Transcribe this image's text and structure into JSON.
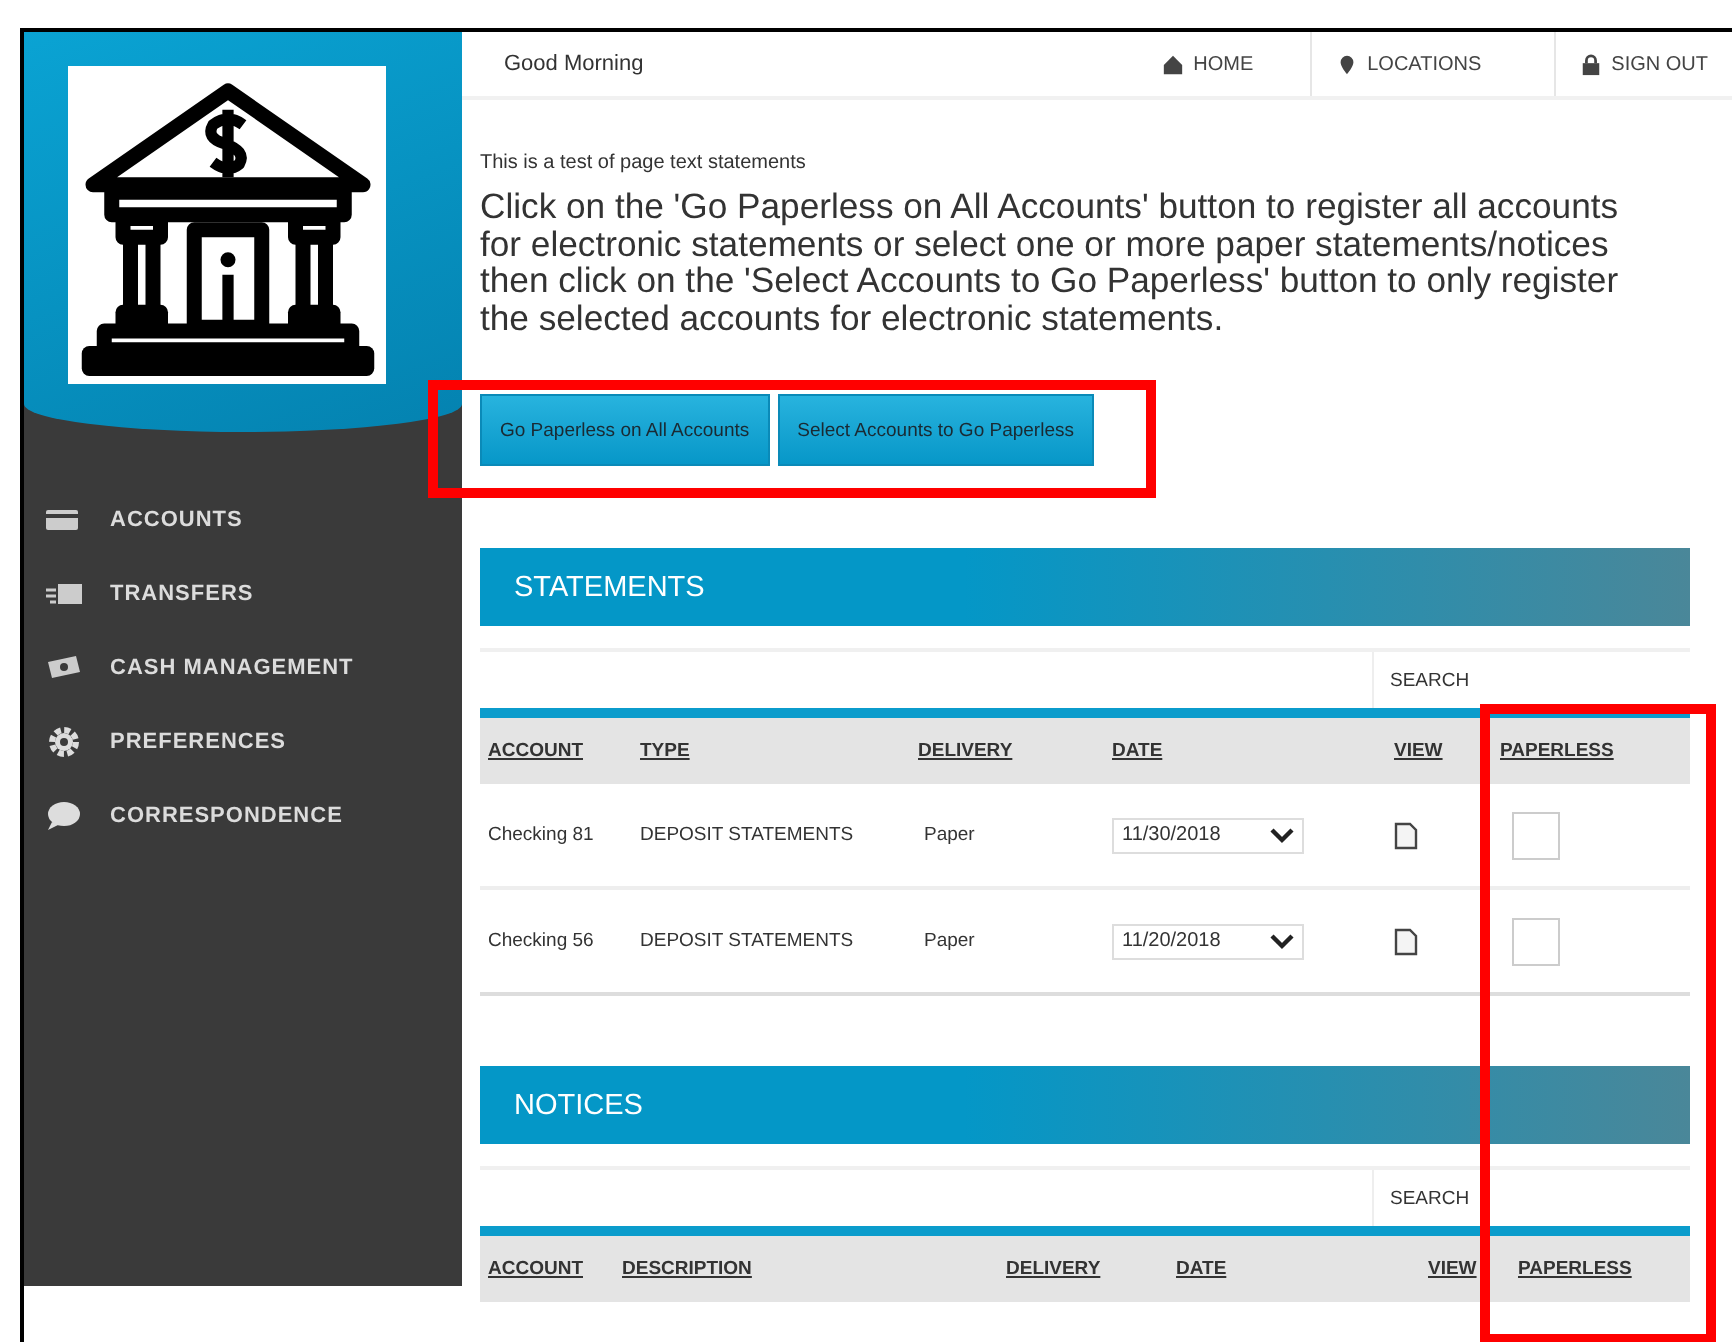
{
  "greeting": "Good Morning",
  "nav": [
    {
      "label": "HOME"
    },
    {
      "label": "LOCATIONS"
    },
    {
      "label": "SIGN OUT"
    }
  ],
  "sidebar": {
    "items": [
      {
        "label": "ACCOUNTS"
      },
      {
        "label": "TRANSFERS"
      },
      {
        "label": "CASH MANAGEMENT"
      },
      {
        "label": "PREFERENCES"
      },
      {
        "label": "CORRESPONDENCE"
      }
    ]
  },
  "intro": "This is a test of page text statements",
  "instructions": "Click on the 'Go Paperless on All Accounts' button to register all accounts for electronic statements or select one or more paper statements/notices then click on the 'Select Accounts to Go Paperless' button to only register the selected accounts for electronic statements.",
  "buttons": [
    "Go Paperless on All Accounts",
    "Select Accounts to Go Paperless"
  ],
  "sections": [
    {
      "title": "STATEMENTS",
      "search": "SEARCH",
      "columns": [
        "ACCOUNT",
        "TYPE",
        "DELIVERY",
        "DATE",
        "VIEW",
        "PAPERLESS"
      ],
      "rows": [
        {
          "account": "Checking 81",
          "type": "DEPOSIT STATEMENTS",
          "delivery": "Paper",
          "date": "11/30/2018",
          "paperless": false
        },
        {
          "account": "Checking 56",
          "type": "DEPOSIT STATEMENTS",
          "delivery": "Paper",
          "date": "11/20/2018",
          "paperless": false
        }
      ]
    },
    {
      "title": "NOTICES",
      "search": "SEARCH",
      "columns": [
        "ACCOUNT",
        "DESCRIPTION",
        "DELIVERY",
        "DATE",
        "VIEW",
        "PAPERLESS"
      ]
    }
  ]
}
